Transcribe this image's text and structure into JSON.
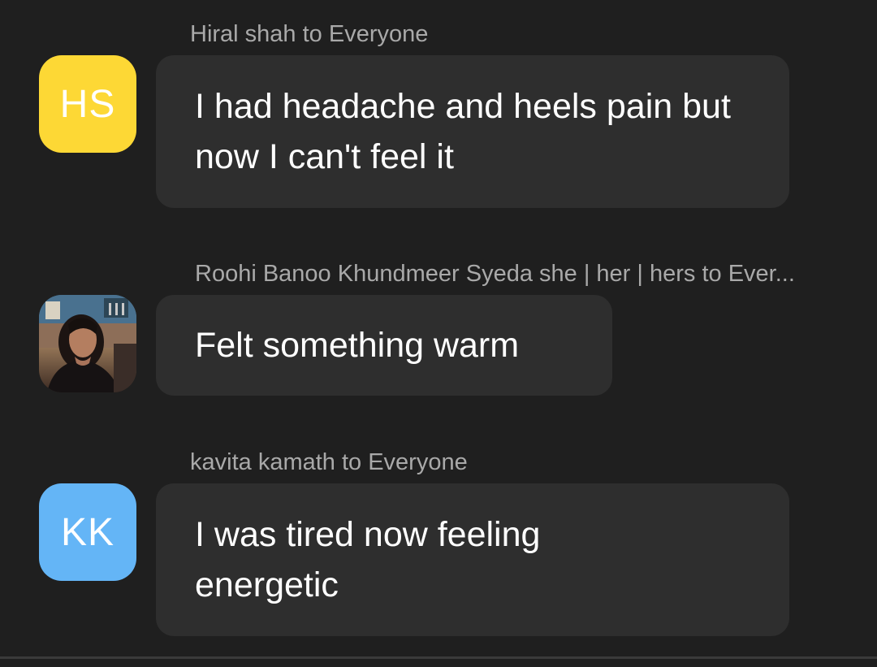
{
  "messages": [
    {
      "sender": "Hiral shah to Everyone",
      "initials": "HS",
      "avatar_color": "#fdd835",
      "avatar_type": "initials",
      "text": "I had headache and heels pain but now I can't feel it"
    },
    {
      "sender": "Roohi Banoo Khundmeer Syeda she | her | hers to Ever...",
      "initials": "",
      "avatar_type": "photo",
      "text": "Felt something warm"
    },
    {
      "sender": "kavita kamath to Everyone",
      "initials": "KK",
      "avatar_color": "#64b5f6",
      "avatar_type": "initials",
      "text": "I was tired now feeling energetic"
    }
  ],
  "colors": {
    "background": "#1f1f1f",
    "bubble": "#2e2e2e",
    "sender_text": "#a9a9a9",
    "message_text": "#ffffff"
  }
}
